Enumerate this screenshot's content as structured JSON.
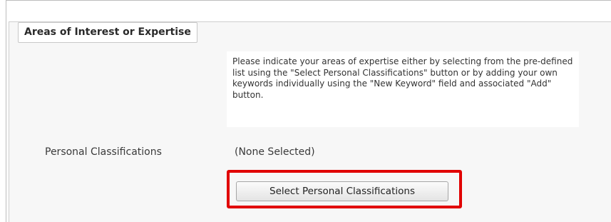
{
  "section": {
    "title": "Areas of Interest or Expertise",
    "instructions": "Please indicate your areas of expertise either by selecting from the pre-defined list using the \"Select Personal Classifications\" button or by adding your own keywords individually using the \"New Keyword\" field and associated \"Add\" button."
  },
  "personal_classifications": {
    "label": "Personal Classifications",
    "value": "(None Selected)",
    "button_label": "Select Personal Classifications"
  },
  "colors": {
    "highlight_border": "#e10000",
    "panel_background": "#f7f7f7"
  }
}
